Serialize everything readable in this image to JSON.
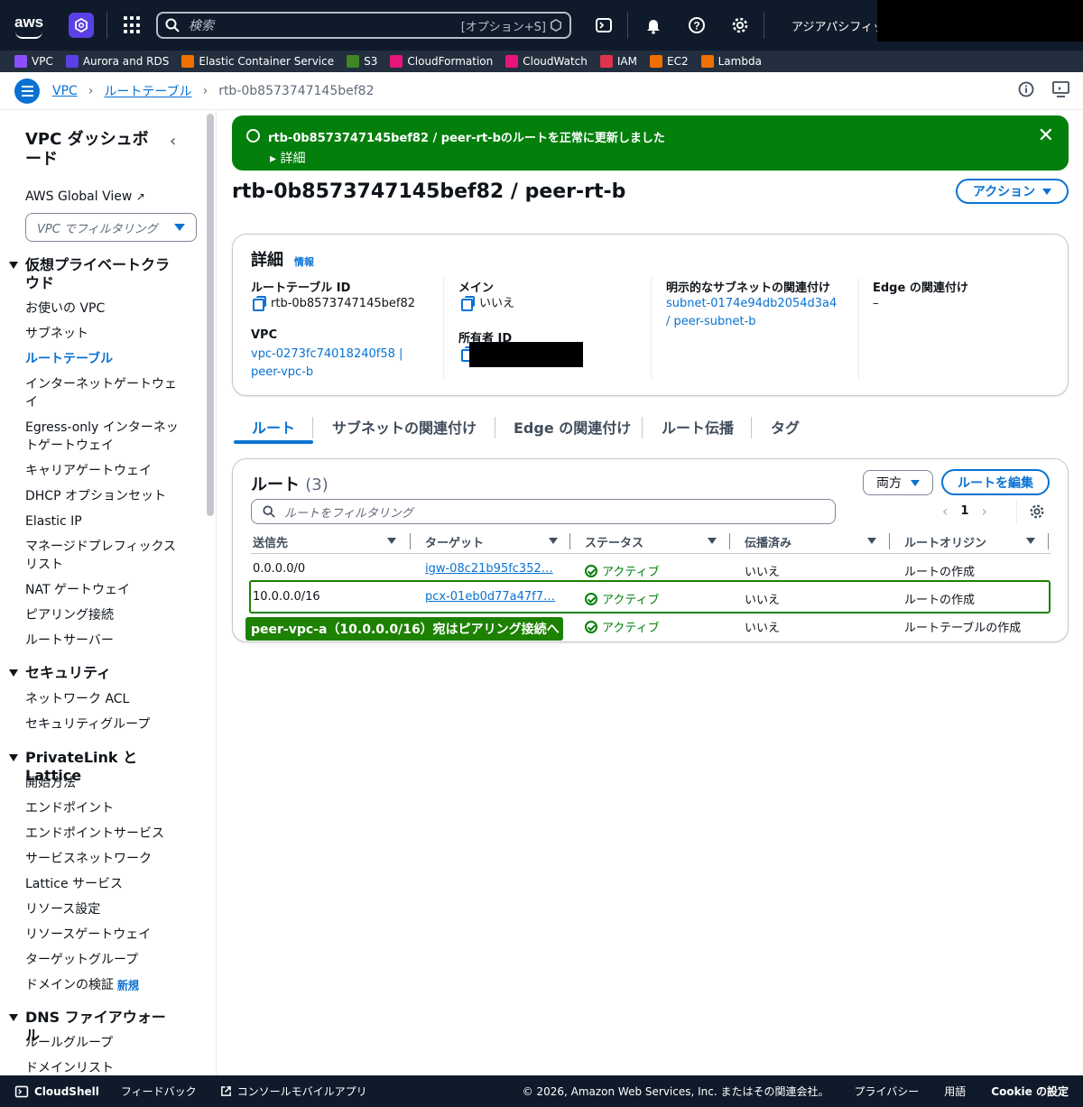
{
  "topnav": {
    "logo": "aws",
    "search_placeholder": "検索",
    "search_shortcut": "[オプション+S]",
    "region": "アジアパシフィック (東京)"
  },
  "favorites": [
    {
      "label": "VPC",
      "color": "#8c4fff"
    },
    {
      "label": "Aurora and RDS",
      "color": "#5a40e6"
    },
    {
      "label": "Elastic Container Service",
      "color": "#ed7100"
    },
    {
      "label": "S3",
      "color": "#3f8624"
    },
    {
      "label": "CloudFormation",
      "color": "#e7157b"
    },
    {
      "label": "CloudWatch",
      "color": "#e7157b"
    },
    {
      "label": "IAM",
      "color": "#dd344c"
    },
    {
      "label": "EC2",
      "color": "#ed7100"
    },
    {
      "label": "Lambda",
      "color": "#ed7100"
    }
  ],
  "breadcrumb": {
    "items": [
      "VPC",
      "ルートテーブル"
    ],
    "current": "rtb-0b8573747145bef82"
  },
  "sidebar": {
    "title": "VPC ダッシュボード",
    "global_view": "AWS Global View",
    "filter_placeholder": "VPC でフィルタリング",
    "sections": [
      {
        "title": "仮想プライベートクラウド",
        "items": [
          "お使いの VPC",
          "サブネット",
          "ルートテーブル",
          "インターネットゲートウェイ",
          "Egress-only インターネットゲートウェイ",
          "キャリアゲートウェイ",
          "DHCP オプションセット",
          "Elastic IP",
          "マネージドプレフィックスリスト",
          "NAT ゲートウェイ",
          "ピアリング接続",
          "ルートサーバー"
        ]
      },
      {
        "title": "セキュリティ",
        "items": [
          "ネットワーク ACL",
          "セキュリティグループ"
        ]
      },
      {
        "title": "PrivateLink と Lattice",
        "items": [
          "開始方法",
          "エンドポイント",
          "エンドポイントサービス",
          "サービスネットワーク",
          "Lattice サービス",
          "リソース設定",
          "リソースゲートウェイ",
          "ターゲットグループ",
          "ドメインの検証"
        ]
      },
      {
        "title": "DNS ファイアウォール",
        "items": [
          "ルールグループ",
          "ドメインリスト"
        ]
      }
    ],
    "new_badge": "新規"
  },
  "flash": {
    "message": "rtb-0b8573747145bef82 / peer-rt-bのルートを正常に更新しました",
    "detail": "詳細"
  },
  "page": {
    "title": "rtb-0b8573747145bef82 / peer-rt-b",
    "action_label": "アクション"
  },
  "details": {
    "heading": "詳細",
    "info": "情報",
    "rt_id_label": "ルートテーブル ID",
    "rt_id": "rtb-0b8573747145bef82",
    "main_label": "メイン",
    "main_value": "いいえ",
    "subnet_label": "明示的なサブネットの関連付け",
    "subnet_value_1": "subnet-0174e94db2054d3a4",
    "subnet_value_2": "/ peer-subnet-b",
    "edge_label": "Edge の関連付け",
    "edge_value": "–",
    "vpc_label": "VPC",
    "vpc_value_1": "vpc-0273fc74018240f58 |",
    "vpc_value_2": "peer-vpc-b",
    "owner_label": "所有者 ID"
  },
  "tabs": [
    "ルート",
    "サブネットの関連付け",
    "Edge の関連付け",
    "ルート伝播",
    "タグ"
  ],
  "routes": {
    "heading": "ルート",
    "count": "(3)",
    "both_label": "両方",
    "edit_label": "ルートを編集",
    "filter_placeholder": "ルートをフィルタリング",
    "page": "1",
    "columns": [
      "送信先",
      "ターゲット",
      "ステータス",
      "伝播済み",
      "ルートオリジン"
    ],
    "rows": [
      {
        "dest": "0.0.0.0/0",
        "target": "igw-08c21b95fc352…",
        "status": "アクティブ",
        "propagated": "いいえ",
        "origin": "ルートの作成"
      },
      {
        "dest": "10.0.0.0/16",
        "target": "pcx-01eb0d77a47f7…",
        "status": "アクティブ",
        "propagated": "いいえ",
        "origin": "ルートの作成"
      },
      {
        "dest": "",
        "target": "",
        "status": "アクティブ",
        "propagated": "いいえ",
        "origin": "ルートテーブルの作成"
      }
    ],
    "annotation": "peer-vpc-a（10.0.0.0/16）宛はピアリング接続へ"
  },
  "footer": {
    "cloudshell": "CloudShell",
    "feedback": "フィードバック",
    "mobile": "コンソールモバイルアプリ",
    "copyright": "© 2026, Amazon Web Services, Inc. またはその関連会社。",
    "privacy": "プライバシー",
    "terms": "用語",
    "cookie": "Cookie の設定"
  }
}
